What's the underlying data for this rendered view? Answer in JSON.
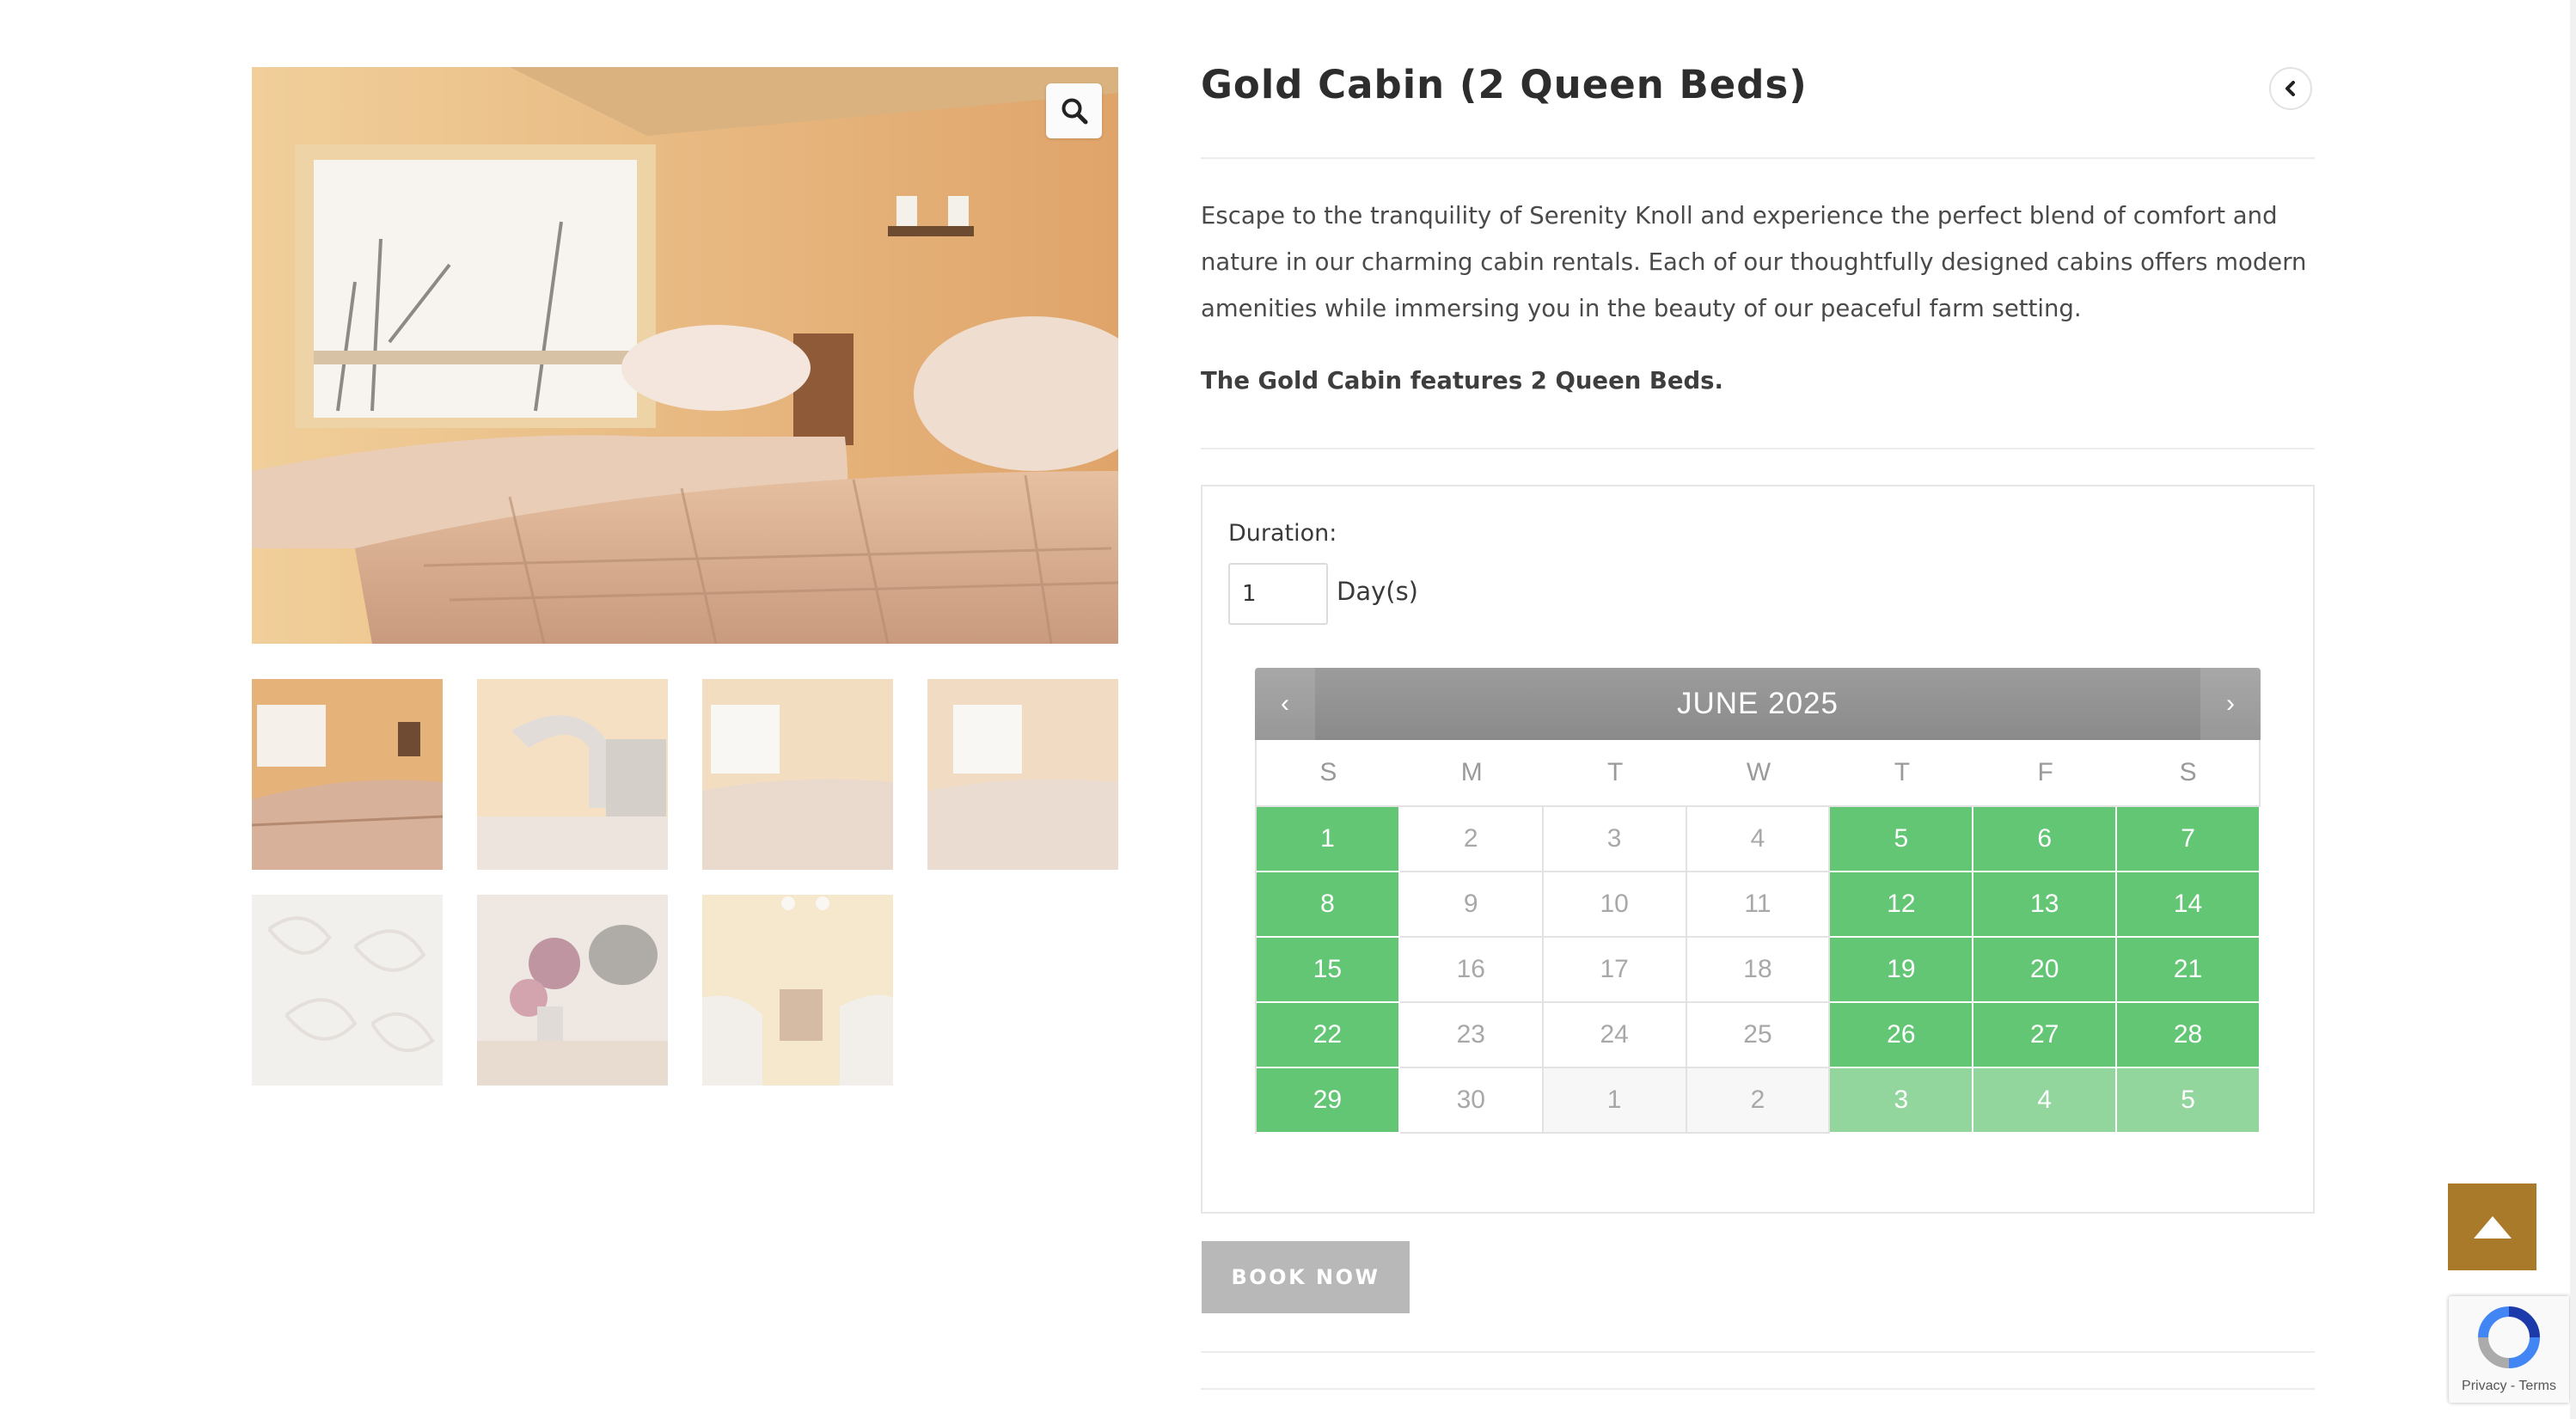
{
  "product": {
    "title": "Gold Cabin (2 Queen Beds)",
    "description": "Escape to the tranquility of Serenity Knoll and experience the perfect blend of comfort and nature in our charming cabin rentals. Each of our thoughtfully designed cabins offers modern amenities while immersing you in the beauty of our peaceful farm setting.",
    "features": "The Gold Cabin features 2 Queen Beds."
  },
  "gallery": {
    "zoom_icon": "magnifier-icon",
    "thumbnail_count": 7
  },
  "booking": {
    "duration_label": "Duration:",
    "duration_value": "1",
    "duration_unit": "Day(s)",
    "book_button": "BOOK NOW"
  },
  "calendar": {
    "month_title": "JUNE 2025",
    "prev_label": "‹",
    "next_label": "›",
    "weekdays": [
      "S",
      "M",
      "T",
      "W",
      "T",
      "F",
      "S"
    ],
    "weeks": [
      [
        {
          "d": "1",
          "s": "avail"
        },
        {
          "d": "2",
          "s": "unavail"
        },
        {
          "d": "3",
          "s": "unavail"
        },
        {
          "d": "4",
          "s": "unavail"
        },
        {
          "d": "5",
          "s": "avail"
        },
        {
          "d": "6",
          "s": "avail"
        },
        {
          "d": "7",
          "s": "avail"
        }
      ],
      [
        {
          "d": "8",
          "s": "avail"
        },
        {
          "d": "9",
          "s": "unavail"
        },
        {
          "d": "10",
          "s": "unavail"
        },
        {
          "d": "11",
          "s": "unavail"
        },
        {
          "d": "12",
          "s": "avail"
        },
        {
          "d": "13",
          "s": "avail"
        },
        {
          "d": "14",
          "s": "avail"
        }
      ],
      [
        {
          "d": "15",
          "s": "avail"
        },
        {
          "d": "16",
          "s": "unavail"
        },
        {
          "d": "17",
          "s": "unavail"
        },
        {
          "d": "18",
          "s": "unavail"
        },
        {
          "d": "19",
          "s": "avail"
        },
        {
          "d": "20",
          "s": "avail"
        },
        {
          "d": "21",
          "s": "avail"
        }
      ],
      [
        {
          "d": "22",
          "s": "avail"
        },
        {
          "d": "23",
          "s": "unavail"
        },
        {
          "d": "24",
          "s": "unavail"
        },
        {
          "d": "25",
          "s": "unavail"
        },
        {
          "d": "26",
          "s": "avail"
        },
        {
          "d": "27",
          "s": "avail"
        },
        {
          "d": "28",
          "s": "avail"
        }
      ],
      [
        {
          "d": "29",
          "s": "avail"
        },
        {
          "d": "30",
          "s": "unavail"
        },
        {
          "d": "1",
          "s": "unavail-other"
        },
        {
          "d": "2",
          "s": "unavail-other"
        },
        {
          "d": "3",
          "s": "avail-other"
        },
        {
          "d": "4",
          "s": "avail-other"
        },
        {
          "d": "5",
          "s": "avail-other"
        }
      ]
    ],
    "colors": {
      "available": "#63c674",
      "available_next_month": "#92d69e",
      "header": "#929292"
    }
  },
  "widgets": {
    "back_to_top_icon": "caret-up-icon",
    "back_to_top_color": "#a87a2a",
    "recaptcha_links": "Privacy - Terms",
    "nav_icon": "chevron-left-icon"
  }
}
